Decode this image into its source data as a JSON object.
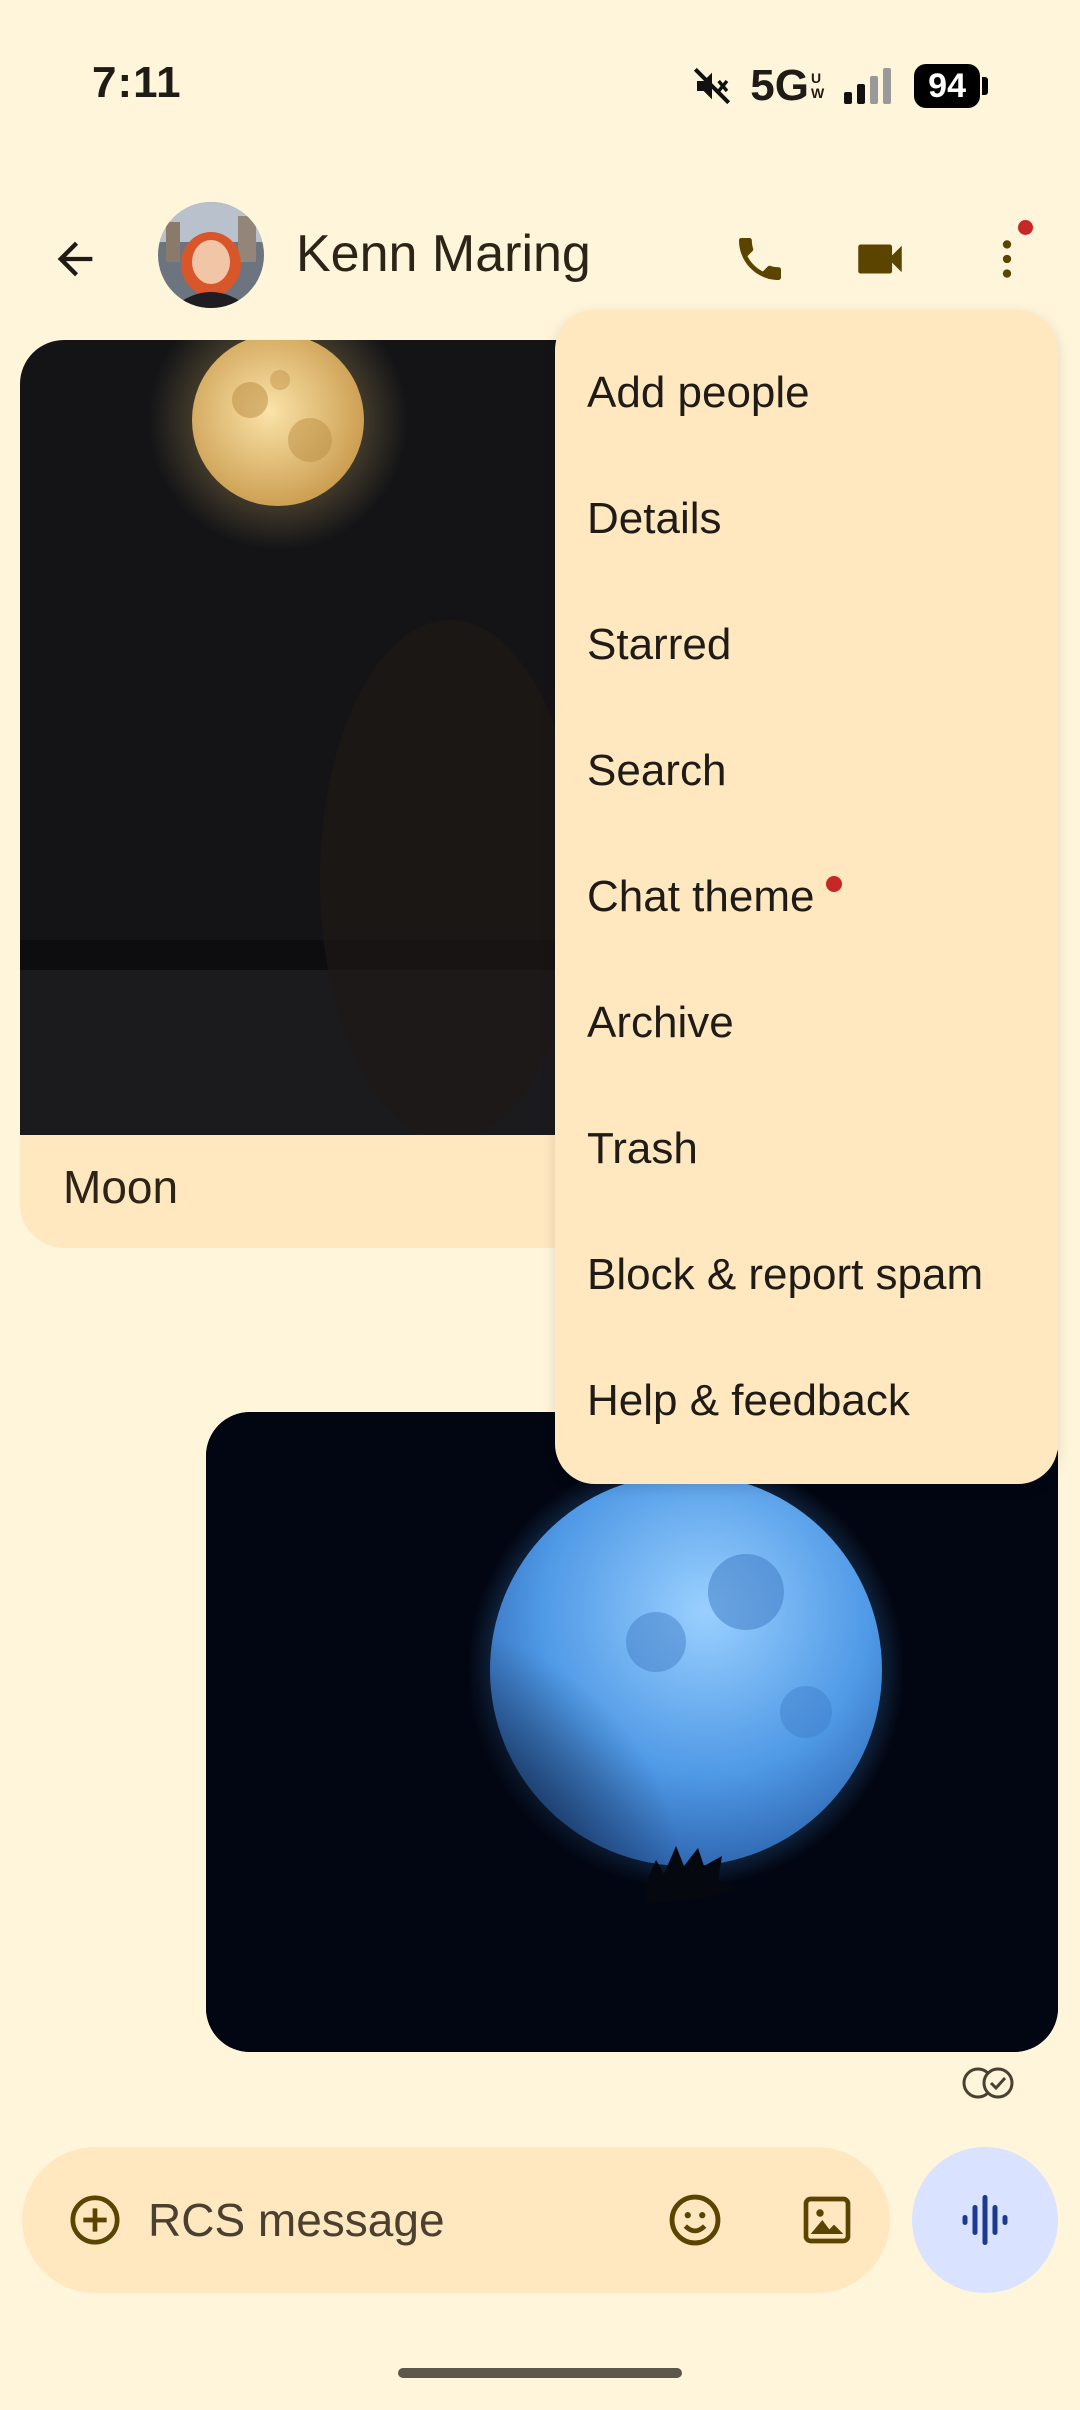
{
  "status_bar": {
    "time": "7:11",
    "network": "5G",
    "network_sub_top": "U",
    "network_sub_bottom": "W",
    "battery": "94",
    "icons": [
      "mute-icon",
      "signal-icon",
      "battery-icon"
    ]
  },
  "header": {
    "contact_name": "Kenn Maring",
    "icons": [
      "back-arrow-icon",
      "phone-icon",
      "video-camera-icon",
      "more-vert-icon"
    ],
    "more_badge_color": "#c62828"
  },
  "messages": [
    {
      "type": "incoming-image",
      "caption": "Moon",
      "image": "full moon (yellow)"
    },
    {
      "type": "outgoing-image",
      "image": "blue moon",
      "status_icon": "read-receipt-icon"
    }
  ],
  "menu": {
    "items": [
      {
        "label": "Add people"
      },
      {
        "label": "Details"
      },
      {
        "label": "Starred"
      },
      {
        "label": "Search"
      },
      {
        "label": "Chat theme",
        "badge": true
      },
      {
        "label": "Archive"
      },
      {
        "label": "Trash"
      },
      {
        "label": "Block & report spam"
      },
      {
        "label": "Help & feedback"
      }
    ]
  },
  "composer": {
    "placeholder": "RCS message",
    "icons": [
      "add-circle-icon",
      "emoji-icon",
      "gallery-icon",
      "voice-waveform-icon"
    ]
  },
  "colors": {
    "background": "#fff5db",
    "surface": "#ffe8c0",
    "accent": "#6b4b00",
    "voice_button": "#d9e2ff",
    "badge": "#c62828"
  }
}
